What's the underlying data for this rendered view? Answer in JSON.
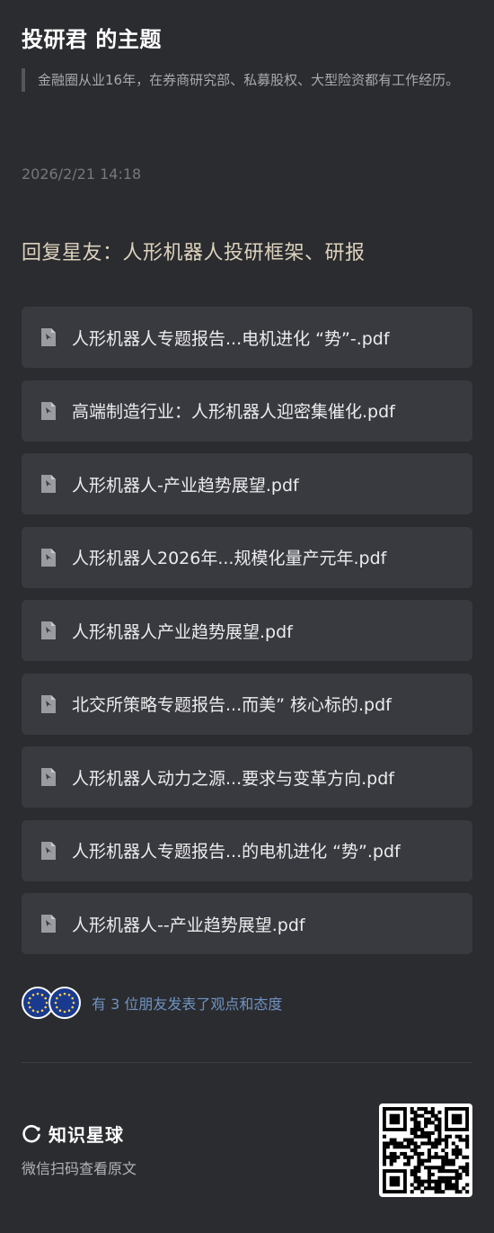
{
  "header": {
    "title": "投研君 的主题",
    "bio": "金融圈从业16年，在券商研究部、私募股权、大型险资都有工作经历。"
  },
  "post": {
    "timestamp": "2026/2/21 14:18",
    "title": "回复星友：人形机器人投研框架、研报"
  },
  "files": [
    {
      "name": "人形机器人专题报告...电机进化 “势”-.pdf",
      "icon": "pdf-file-icon"
    },
    {
      "name": "高端制造行业：人形机器人迎密集催化.pdf",
      "icon": "pdf-file-icon"
    },
    {
      "name": "人形机器人-产业趋势展望.pdf",
      "icon": "pdf-file-icon"
    },
    {
      "name": "人形机器人2026年...规模化量产元年.pdf",
      "icon": "pdf-file-icon"
    },
    {
      "name": "人形机器人产业趋势展望.pdf",
      "icon": "pdf-file-icon"
    },
    {
      "name": "北交所策略专题报告...而美” 核心标的.pdf",
      "icon": "pdf-file-icon"
    },
    {
      "name": "人形机器人动力之源...要求与变革方向.pdf",
      "icon": "pdf-file-icon"
    },
    {
      "name": "人形机器人专题报告...的电机进化 “势”.pdf",
      "icon": "pdf-file-icon"
    },
    {
      "name": "人形机器人--产业趋势展望.pdf",
      "icon": "pdf-file-icon"
    }
  ],
  "reactions": {
    "text": "有 3 位朋友发表了观点和态度",
    "avatars": [
      "eu-flag-avatar",
      "eu-flag-avatar"
    ]
  },
  "footer": {
    "brand": "知识星球",
    "scan_text": "微信扫码查看原文",
    "qr_icon": "qr-code"
  },
  "colors": {
    "background": "#2b2c30",
    "card": "#393a3f",
    "post_title": "#dcd2bd",
    "link": "#6f93c2"
  }
}
